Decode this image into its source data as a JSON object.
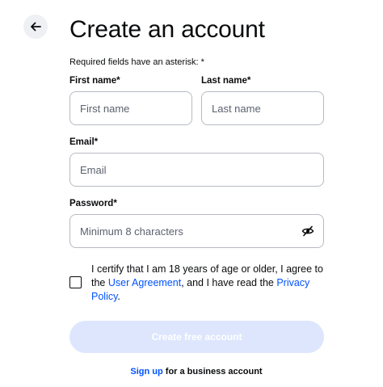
{
  "header": {
    "back_icon": "arrow-left-icon",
    "title": "Create an account"
  },
  "form": {
    "required_note": "Required fields have an asterisk: *",
    "first_name": {
      "label": "First name*",
      "placeholder": "First name",
      "value": ""
    },
    "last_name": {
      "label": "Last name*",
      "placeholder": "Last name",
      "value": ""
    },
    "email": {
      "label": "Email*",
      "placeholder": "Email",
      "value": ""
    },
    "password": {
      "label": "Password*",
      "placeholder": "Minimum 8 characters",
      "value": "",
      "toggle_icon": "eye-slash-icon"
    },
    "certify": {
      "checked": false,
      "text_before": "I certify that I am 18 years of age or older, I agree to the ",
      "user_agreement_link": "User Agreement",
      "text_middle": ", and I have read the ",
      "privacy_policy_link": "Privacy Policy",
      "text_after": "."
    },
    "submit_label": "Create free account",
    "business": {
      "link_text": "Sign up",
      "rest_text": " for a business account"
    }
  },
  "colors": {
    "accent": "#0052ff",
    "button_disabled_bg": "#dde6fd",
    "border": "#b6bac2",
    "text": "#0a0b0d"
  }
}
